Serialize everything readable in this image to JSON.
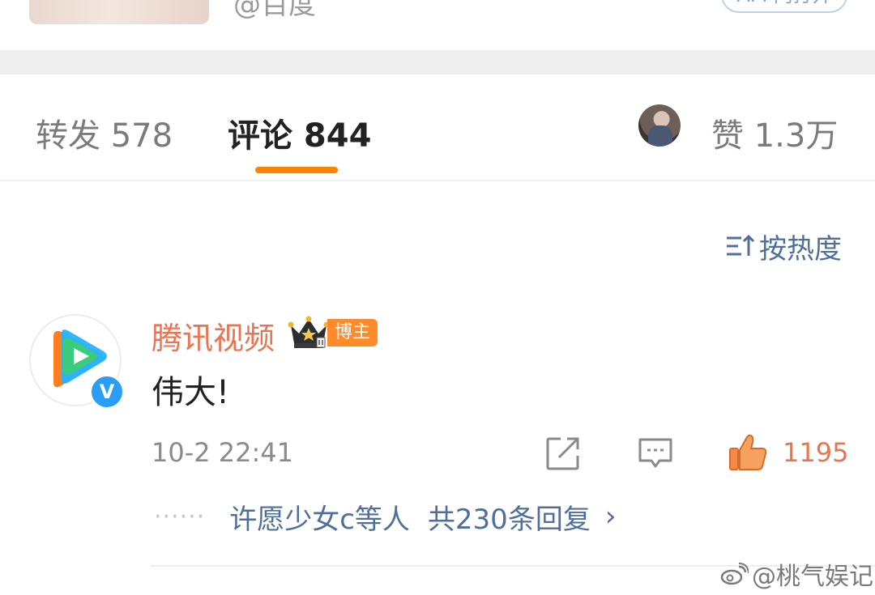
{
  "top_card": {
    "handle": "@百度",
    "open_button": "APP内打开"
  },
  "tabs": {
    "repost": "转发 578",
    "comment": "评论 844",
    "like": "赞 1.3万"
  },
  "sort": {
    "label": "按热度"
  },
  "comment": {
    "user_name": "腾讯视频",
    "user_badge": "博主",
    "verified_mark": "V",
    "text": "伟大!",
    "time": "10-2 22:41",
    "like_count": "1195",
    "replies": {
      "dots": "······",
      "users": "许愿少女c等人",
      "count": "共230条回复",
      "chevron": "›"
    }
  },
  "watermark": {
    "text": "@桃气娱记"
  },
  "colors": {
    "accent_orange": "#ff8200",
    "name_orange": "#eb7350",
    "link_blue": "#4f6f9a",
    "verified_blue": "#2a9df4"
  }
}
